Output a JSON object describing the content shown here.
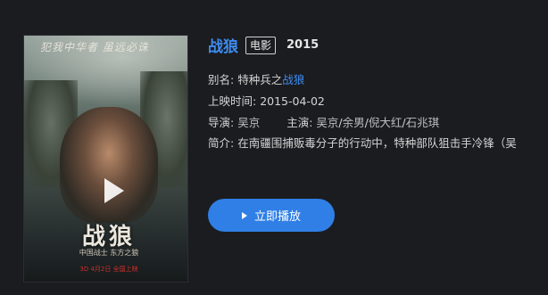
{
  "movie": {
    "title": "战狼",
    "genre_badge": "电影",
    "year": "2015"
  },
  "poster": {
    "calligraphy_text": "犯我中华者 虽远必诛",
    "logo_text": "战狼",
    "logo_subtitle": "中国战士 东方之狼",
    "logo_bottom": "3D 4月2日 全国上映"
  },
  "details": {
    "alias_label": "别名:",
    "alias_prefix": "特种兵之",
    "alias_link": "战狼",
    "release_label": "上映时间:",
    "release_date": "2015-04-02",
    "director_label": "导演:",
    "director": "吴京",
    "cast_label": "主演:",
    "cast": [
      "吴京",
      "余男",
      "倪大红",
      "石兆琪"
    ],
    "cast_separator": "/",
    "intro_label": "简介:",
    "intro_text": "在南疆围捕贩毒分子的行动中，特种部队狙击手冷锋（吴"
  },
  "actions": {
    "play_label": "立即播放"
  },
  "icons": {
    "poster_play": "play-icon",
    "button_play": "play-icon"
  },
  "colors": {
    "background": "#1b1c20",
    "accent": "#3d8cf0",
    "button": "#2f7fe6"
  }
}
